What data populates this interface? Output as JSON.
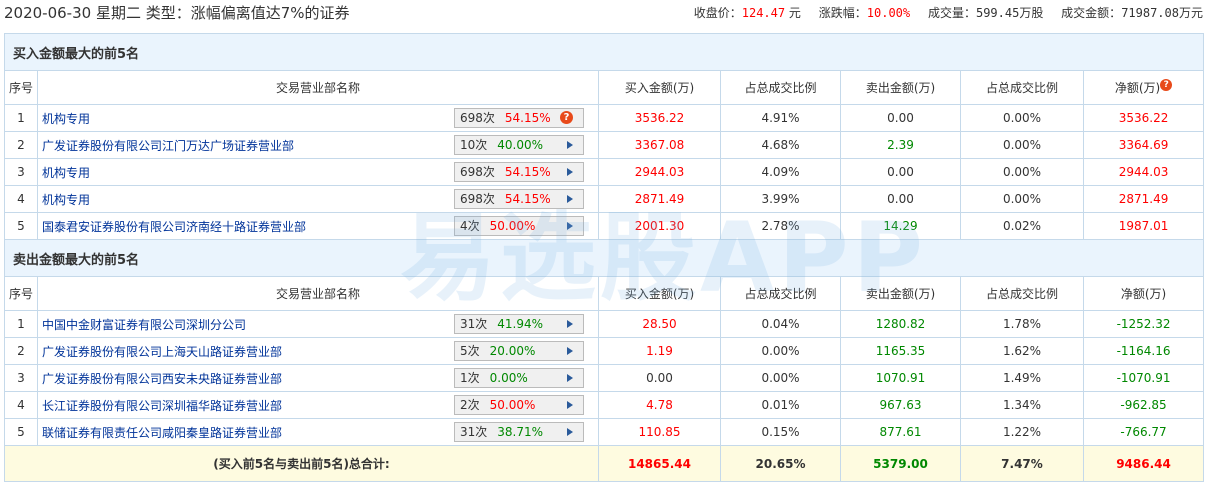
{
  "header": {
    "title": "2020-06-30 星期二  类型：涨幅偏离值达7%的证券",
    "close_label": "收盘价：",
    "close": "124.47",
    "close_unit": " 元",
    "chg_label": "涨跌幅：",
    "chg": "10.00%",
    "vol_label": "成交量：",
    "vol": "599.45万股",
    "amt_label": "成交金额：",
    "amt": "71987.08万元"
  },
  "columns": [
    "序号",
    "交易营业部名称",
    "买入金额(万)",
    "占总成交比例",
    "卖出金额(万)",
    "占总成交比例",
    "净额(万)"
  ],
  "buy": {
    "title": "买入金额最大的前5名",
    "rows": [
      {
        "no": "1",
        "name": "机构专用",
        "times": "698次",
        "pct": "54.15%",
        "pct_color": "red",
        "icon": "help",
        "buy": "3536.22",
        "buy_pct": "4.91%",
        "sell": "0.00",
        "sell_pct": "0.00%",
        "net": "3536.22"
      },
      {
        "no": "2",
        "name": "广发证券股份有限公司江门万达广场证券营业部",
        "times": "10次",
        "pct": "40.00%",
        "pct_color": "green",
        "icon": "arrow",
        "buy": "3367.08",
        "buy_pct": "4.68%",
        "sell": "2.39",
        "sell_pct": "0.00%",
        "net": "3364.69"
      },
      {
        "no": "3",
        "name": "机构专用",
        "times": "698次",
        "pct": "54.15%",
        "pct_color": "red",
        "icon": "arrow",
        "buy": "2944.03",
        "buy_pct": "4.09%",
        "sell": "0.00",
        "sell_pct": "0.00%",
        "net": "2944.03"
      },
      {
        "no": "4",
        "name": "机构专用",
        "times": "698次",
        "pct": "54.15%",
        "pct_color": "red",
        "icon": "arrow",
        "buy": "2871.49",
        "buy_pct": "3.99%",
        "sell": "0.00",
        "sell_pct": "0.00%",
        "net": "2871.49"
      },
      {
        "no": "5",
        "name": "国泰君安证券股份有限公司济南经十路证券营业部",
        "times": "4次",
        "pct": "50.00%",
        "pct_color": "red",
        "icon": "arrow",
        "buy": "2001.30",
        "buy_pct": "2.78%",
        "sell": "14.29",
        "sell_pct": "0.02%",
        "net": "1987.01"
      }
    ]
  },
  "sell": {
    "title": "卖出金额最大的前5名",
    "rows": [
      {
        "no": "1",
        "name": "中国中金财富证券有限公司深圳分公司",
        "times": "31次",
        "pct": "41.94%",
        "pct_color": "green",
        "icon": "arrow",
        "buy": "28.50",
        "buy_pct": "0.04%",
        "sell": "1280.82",
        "sell_pct": "1.78%",
        "net": "-1252.32"
      },
      {
        "no": "2",
        "name": "广发证券股份有限公司上海天山路证券营业部",
        "times": "5次",
        "pct": "20.00%",
        "pct_color": "green",
        "icon": "arrow",
        "buy": "1.19",
        "buy_pct": "0.00%",
        "sell": "1165.35",
        "sell_pct": "1.62%",
        "net": "-1164.16"
      },
      {
        "no": "3",
        "name": "广发证券股份有限公司西安未央路证券营业部",
        "times": "1次",
        "pct": "0.00%",
        "pct_color": "green",
        "icon": "arrow",
        "buy": "0.00",
        "buy_pct": "0.00%",
        "sell": "1070.91",
        "sell_pct": "1.49%",
        "net": "-1070.91"
      },
      {
        "no": "4",
        "name": "长江证券股份有限公司深圳福华路证券营业部",
        "times": "2次",
        "pct": "50.00%",
        "pct_color": "red",
        "icon": "arrow",
        "buy": "4.78",
        "buy_pct": "0.01%",
        "sell": "967.63",
        "sell_pct": "1.34%",
        "net": "-962.85"
      },
      {
        "no": "5",
        "name": "联储证券有限责任公司咸阳秦皇路证券营业部",
        "times": "31次",
        "pct": "38.71%",
        "pct_color": "green",
        "icon": "arrow",
        "buy": "110.85",
        "buy_pct": "0.15%",
        "sell": "877.61",
        "sell_pct": "1.22%",
        "net": "-766.77"
      }
    ]
  },
  "total": {
    "label": "(买入前5名与卖出前5名)总合计:",
    "buy": "14865.44",
    "buy_pct": "20.65%",
    "sell": "5379.00",
    "sell_pct": "7.47%",
    "net": "9486.44"
  },
  "watermark": "易选股APP",
  "help_glyph": "?"
}
